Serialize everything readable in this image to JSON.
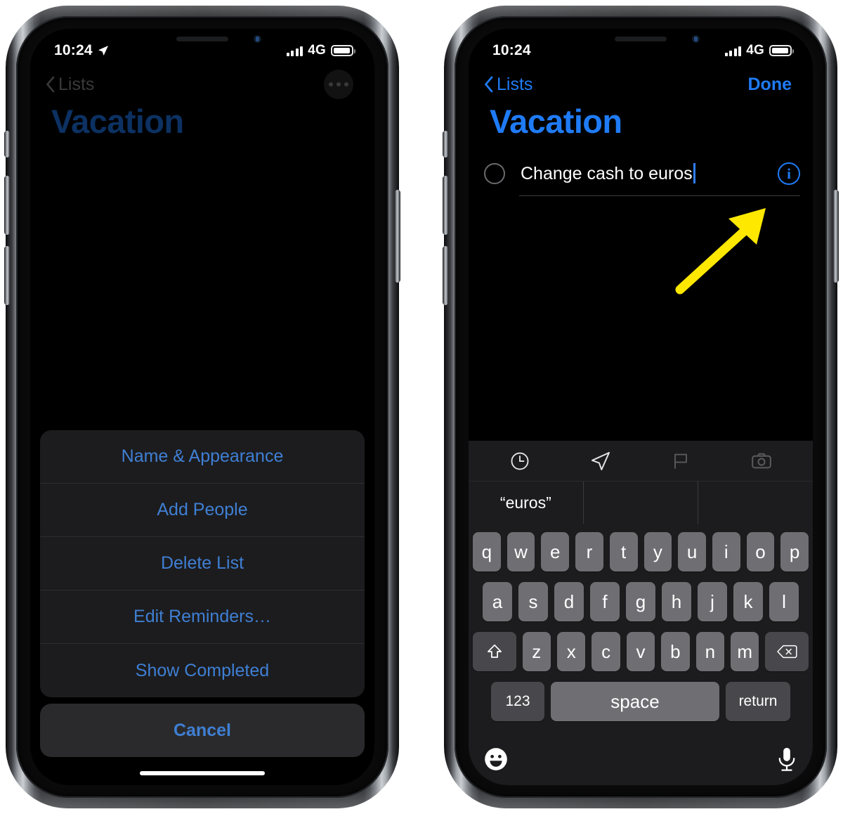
{
  "left_phone": {
    "status_bar": {
      "time": "10:24",
      "location_icon": "location-arrow-icon",
      "network": "4G",
      "signal_icon": "signal-bars-icon",
      "battery_icon": "battery-icon"
    },
    "nav": {
      "back_label": "Lists",
      "back_icon": "chevron-left-icon",
      "more_icon": "ellipsis-icon"
    },
    "title": "Vacation",
    "action_sheet": {
      "items": [
        {
          "label": "Name & Appearance"
        },
        {
          "label": "Add People"
        },
        {
          "label": "Delete List"
        },
        {
          "label": "Edit Reminders…"
        },
        {
          "label": "Show Completed"
        }
      ],
      "cancel_label": "Cancel"
    }
  },
  "right_phone": {
    "status_bar": {
      "time": "10:24",
      "network": "4G",
      "signal_icon": "signal-bars-icon",
      "battery_icon": "battery-icon"
    },
    "nav": {
      "back_label": "Lists",
      "back_icon": "chevron-left-icon",
      "done_label": "Done"
    },
    "title": "Vacation",
    "reminder": {
      "text": "Change cash to euros",
      "checkbox_icon": "circle-checkbox-icon",
      "info_icon": "info-circle-icon",
      "info_label": "i"
    },
    "keyboard": {
      "toolbar_icons": [
        "clock-icon",
        "location-arrow-icon",
        "flag-icon",
        "camera-icon"
      ],
      "predictions": [
        "“euros”",
        "",
        ""
      ],
      "row1": [
        "q",
        "w",
        "e",
        "r",
        "t",
        "y",
        "u",
        "i",
        "o",
        "p"
      ],
      "row2": [
        "a",
        "s",
        "d",
        "f",
        "g",
        "h",
        "j",
        "k",
        "l"
      ],
      "row3": [
        "z",
        "x",
        "c",
        "v",
        "b",
        "n",
        "m"
      ],
      "shift_icon": "shift-arrow-icon",
      "backspace_icon": "backspace-icon",
      "numbers_label": "123",
      "space_label": "space",
      "return_label": "return",
      "emoji_icon": "emoji-smiley-icon",
      "dictation_icon": "microphone-icon"
    }
  },
  "annotation": {
    "arrow_icon": "yellow-arrow-icon",
    "arrow_color": "#FFE800"
  },
  "colors": {
    "accent_blue": "#1f7bf5",
    "sheet_blue": "#3f7fd4",
    "sheet_bg": "#1c1c1e",
    "cancel_bg": "#2a2a2c",
    "key_bg": "#6e6e73",
    "key_dark_bg": "#48484c"
  }
}
